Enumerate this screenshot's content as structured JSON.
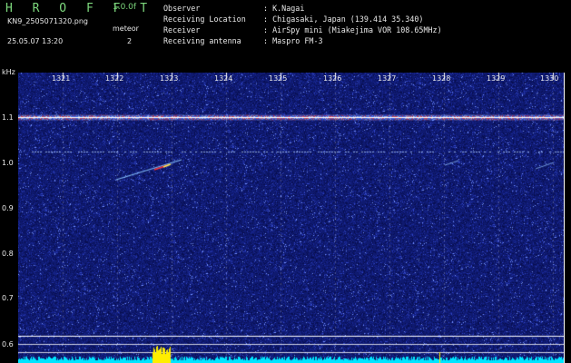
{
  "app": {
    "title": "H R O F F T",
    "version": "1.0.0f"
  },
  "file": {
    "name": "KN9_2505071320.png",
    "datetime": "25.05.07 13:20"
  },
  "mode": {
    "label": "meteor",
    "count": "2"
  },
  "info": [
    {
      "key": "Observer",
      "value": ": K.Nagai"
    },
    {
      "key": "Receiving Location",
      "value": ": Chigasaki, Japan (139.414 35.340)"
    },
    {
      "key": "Receiver",
      "value": ": AirSpy mini (Miakejima VOR 108.65MHz)"
    },
    {
      "key": "Receiving antenna",
      "value": ": Maspro FM-3"
    }
  ],
  "axis": {
    "y_unit": "kHz",
    "y_ticks": [
      "1.1",
      "1.0",
      "0.9",
      "0.8",
      "0.7",
      "0.6"
    ],
    "x_ticks": [
      "1321",
      "1322",
      "1323",
      "1324",
      "1325",
      "1326",
      "1327",
      "1328",
      "1329",
      "1330"
    ]
  },
  "colors": {
    "background": "#000000",
    "noise_bg": "#0f1a70",
    "title_green": "#7dd87d",
    "text": "#e8e8e8",
    "baseline": "#00e5ff",
    "peak": "#ffee00"
  }
}
